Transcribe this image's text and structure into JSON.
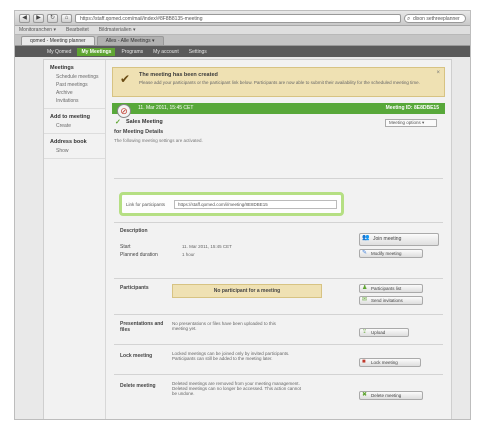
{
  "browser": {
    "url": "https://staff.qomed.com/mail/index/#8F8B8135-meeting",
    "search": "dixon sethreeplanner",
    "bookmarks": [
      "Monitoranchen ▾",
      "Bearbeitet",
      "Bildmaterialien ▾"
    ],
    "tabs": [
      "qomed - Meeting planner",
      "Alles - Alle Meetings ▾"
    ]
  },
  "appnav": [
    "My Qomed",
    "My Meetings",
    "Programs",
    "My account",
    "Settings"
  ],
  "sidebar": {
    "groups": [
      {
        "title": "Meetings",
        "items": [
          "Schedule meetings",
          "Past meetings",
          "Archive",
          "Invitations"
        ]
      },
      {
        "title": "Add to meeting",
        "items": [
          "Create"
        ]
      },
      {
        "title": "Address book",
        "items": [
          "Show"
        ]
      }
    ]
  },
  "notice": {
    "title": "The meeting has been created",
    "text": "Please add your participants or the participant link below. Participants are now able to submit their availability for the scheduled meeting time.",
    "close": "×"
  },
  "meeting_bar": {
    "date": "11. Mar 2011, 15:45 CET",
    "id": "Meeting ID: 8E8DBE15"
  },
  "meeting": {
    "title": "Sales Meeting",
    "status": "Meeting options ▾",
    "subtitle": "for Meeting Details",
    "note": "The following meeting settings are activated."
  },
  "link": {
    "label": "Link for participants",
    "value": "https://staff.qomed.com/i/meeting/8E8DBE15"
  },
  "description": {
    "label": "Description",
    "start_label": "Start",
    "start_value": "11. Mar 2011, 15:45 CET",
    "duration_label": "Planned duration",
    "duration_value": "1 hour",
    "join_button": "Join meeting",
    "modify_button": "Modify meeting"
  },
  "participants": {
    "label": "Participants",
    "empty": "No participant for a meeting",
    "add_button": "Participants list",
    "invite_button": "Send invitations"
  },
  "presentations": {
    "label": "Presentations and files",
    "text": "No presentations or files have been uploaded to this meeting yet.",
    "button": "Upload"
  },
  "lock": {
    "label": "Lock meeting",
    "text": "Locked meetings can be joined only by invited participants. Participants can still be added to the meeting later.",
    "button": "Lock meeting"
  },
  "delete": {
    "label": "Delete meeting",
    "text": "Deleted meetings are removed from your meeting management. Deleted meetings can no longer be accessed. This action cannot be undone.",
    "button": "Delete meeting"
  }
}
